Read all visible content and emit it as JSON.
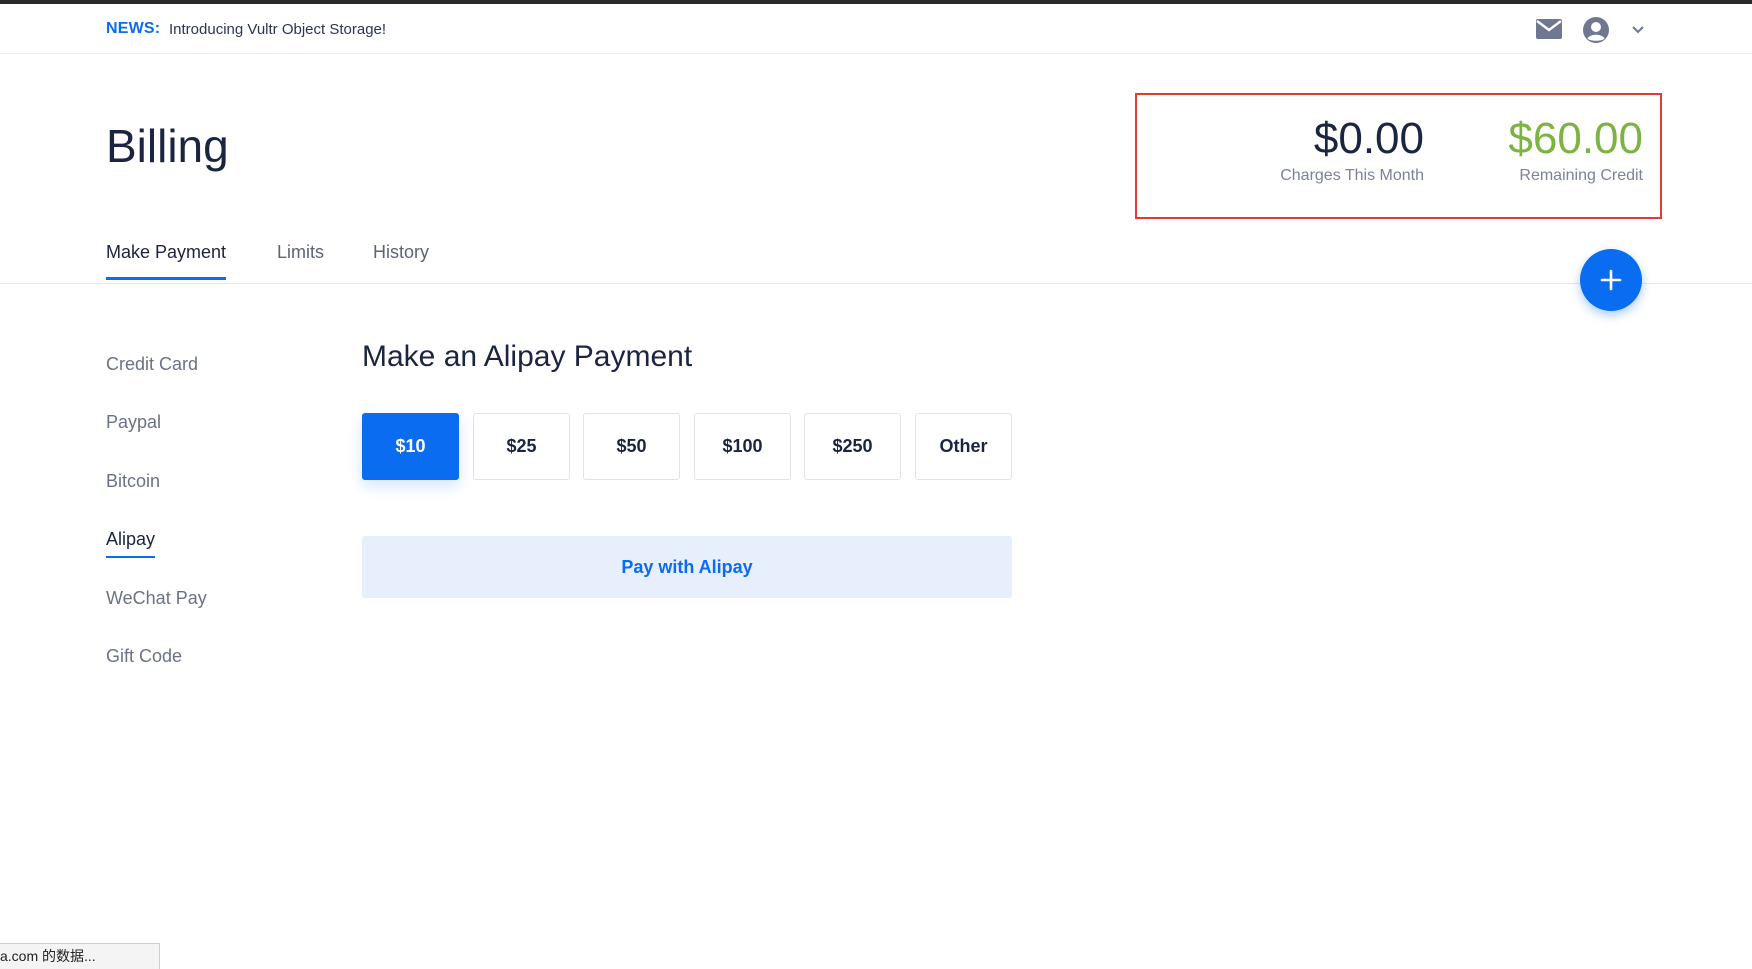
{
  "newsbar": {
    "tag": "NEWS:",
    "text": "Introducing Vultr Object Storage!",
    "icons": [
      "mail-icon",
      "user-icon",
      "chevron-down-icon"
    ]
  },
  "page": {
    "title": "Billing"
  },
  "summary": {
    "charges_value": "$0.00",
    "charges_label": "Charges This Month",
    "credit_value": "$60.00",
    "credit_label": "Remaining Credit"
  },
  "tabs": [
    {
      "label": "Make Payment",
      "active": true
    },
    {
      "label": "Limits",
      "active": false
    },
    {
      "label": "History",
      "active": false
    }
  ],
  "fab": {
    "icon": "plus-icon"
  },
  "sidenav": [
    {
      "label": "Credit Card",
      "active": false
    },
    {
      "label": "Paypal",
      "active": false
    },
    {
      "label": "Bitcoin",
      "active": false
    },
    {
      "label": "Alipay",
      "active": true
    },
    {
      "label": "WeChat Pay",
      "active": false
    },
    {
      "label": "Gift Code",
      "active": false
    }
  ],
  "payment": {
    "title": "Make an Alipay Payment",
    "amounts": [
      {
        "label": "$10",
        "selected": true
      },
      {
        "label": "$25",
        "selected": false
      },
      {
        "label": "$50",
        "selected": false
      },
      {
        "label": "$100",
        "selected": false
      },
      {
        "label": "$250",
        "selected": false
      },
      {
        "label": "Other",
        "selected": false
      }
    ],
    "submit_label": "Pay with Alipay"
  },
  "status_bar": {
    "text": "a.com 的数据..."
  },
  "colors": {
    "accent": "#0a6cf0",
    "credit_green": "#7cb342",
    "highlight_red": "#e53935"
  }
}
